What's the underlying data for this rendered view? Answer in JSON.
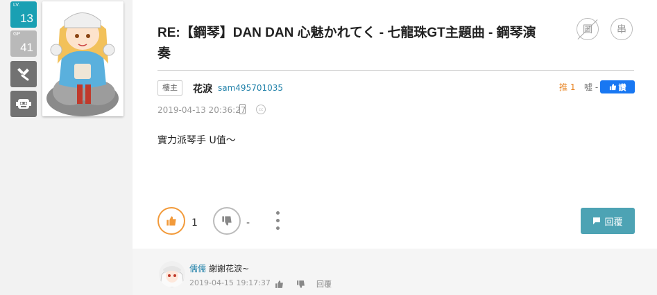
{
  "user_badges": {
    "level_label": "LV.",
    "level": "13",
    "gp_label": "GP",
    "gp": "41"
  },
  "post": {
    "title": "RE:【鋼琴】DAN DAN 心魅かれてく - 七龍珠GT主題曲 - 鋼琴演奏",
    "icon_image_label": "圖",
    "icon_thread_label": "串",
    "owner_tag": "樓主",
    "author_name": "花淚",
    "author_id": "sam495701035",
    "push_label": "推 1",
    "boo_label": "噓 -",
    "fb_like_label": "讚",
    "timestamp": "2019-04-13 20:36:27",
    "cc_label": "cc",
    "body": "實力派琴手 U值～",
    "upvotes": "1",
    "downvotes": "-",
    "reply_label": "回覆"
  },
  "comment": {
    "author": "儒儒",
    "text": "謝謝花淚~",
    "timestamp": "2019-04-15 19:17:37",
    "reply_label": "回覆"
  },
  "colors": {
    "accent_teal": "#1aa0b3",
    "push_orange": "#e8821f",
    "link_blue": "#1d7fa8",
    "reply_button": "#4da3b4",
    "facebook_blue": "#1877f2"
  }
}
